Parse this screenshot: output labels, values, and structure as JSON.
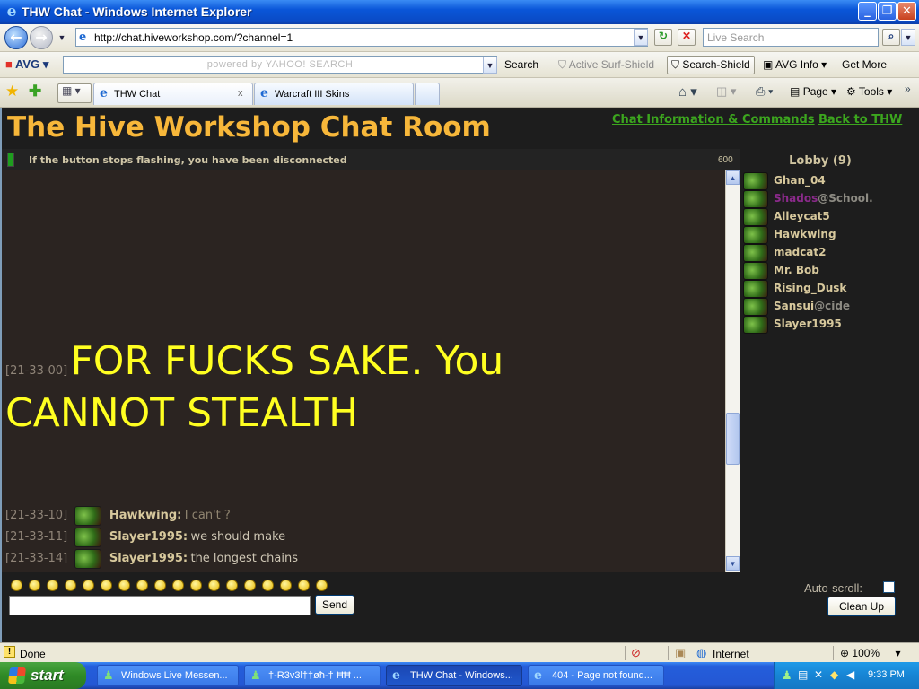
{
  "window": {
    "title": "THW Chat - Windows Internet Explorer"
  },
  "address": {
    "url": "http://chat.hiveworkshop.com/?channel=1",
    "search_placeholder": "Live Search"
  },
  "avg_toolbar": {
    "logo": "AVG",
    "powered_by": "powered by YAHOO! SEARCH",
    "search_label": "Search",
    "active_surf_shield": "Active  Surf-Shield",
    "search_shield": "Search-Shield",
    "avg_info": "AVG Info",
    "get_more": "Get More"
  },
  "tabs": [
    {
      "label": "THW Chat",
      "active": true
    },
    {
      "label": "Warcraft III Skins",
      "active": false
    }
  ],
  "command_bar": {
    "page": "Page",
    "tools": "Tools"
  },
  "chat": {
    "title": "The Hive Workshop Chat Room",
    "links": [
      "Chat Information & Commands",
      "Back to THW"
    ],
    "status_text": "If the button stops flashing, you have been disconnected",
    "counter": "600",
    "messages": [
      {
        "time": "[21-33-00]",
        "user": "",
        "text": "FOR FUCKS SAKE. You CANNOT STEALTH",
        "big": true
      },
      {
        "time": "[21-33-10]",
        "user": "Hawkwing:",
        "text": "I can't ?",
        "muted": true
      },
      {
        "time": "[21-33-11]",
        "user": "Slayer1995:",
        "text": "we should make"
      },
      {
        "time": "[21-33-14]",
        "user": "Slayer1995:",
        "text": "the longest chains"
      }
    ],
    "lobby": {
      "title": "Lobby (9)",
      "users": [
        {
          "name": "Ghan_04"
        },
        {
          "name": "Shados",
          "suffix": "@School.",
          "color": "#8b2a8b"
        },
        {
          "name": "Alleycat5"
        },
        {
          "name": "Hawkwing"
        },
        {
          "name": "madcat2"
        },
        {
          "name": "Mr. Bob"
        },
        {
          "name": "Rising_Dusk"
        },
        {
          "name": "Sansui",
          "suffix": "@cide"
        },
        {
          "name": "Slayer1995"
        }
      ]
    },
    "send_label": "Send",
    "autoscroll_label": "Auto-scroll:",
    "cleanup_label": "Clean Up"
  },
  "statusbar": {
    "status": "Done",
    "zone": "Internet",
    "zoom": "100%"
  },
  "taskbar": {
    "start": "start",
    "tasks": [
      {
        "label": "Windows Live Messen...",
        "active": false
      },
      {
        "label": "†-R3v3l††øħ-† ĦĦ ...",
        "active": false
      },
      {
        "label": "THW Chat - Windows...",
        "active": true
      },
      {
        "label": "404 - Page not found...",
        "active": false
      }
    ],
    "clock": "9:33 PM"
  }
}
